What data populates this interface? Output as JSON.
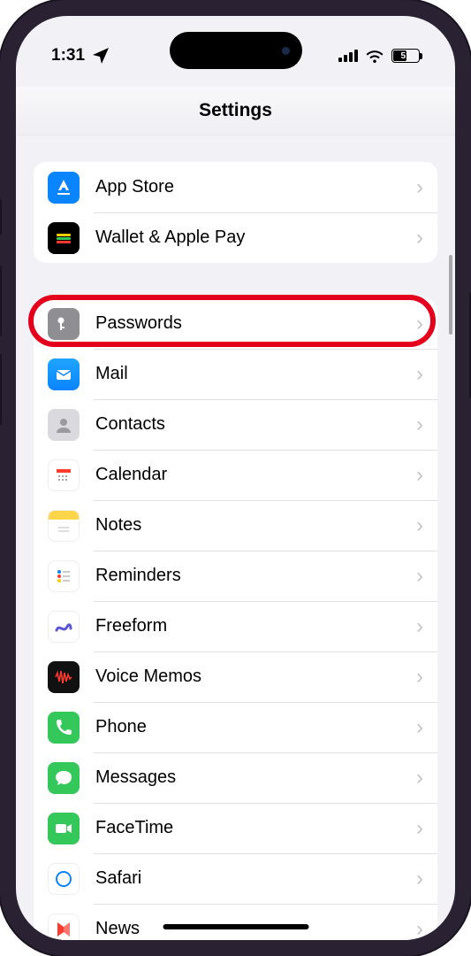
{
  "status": {
    "time": "1:31",
    "battery": "51"
  },
  "header": {
    "title": "Settings"
  },
  "groups": [
    {
      "items": [
        {
          "id": "appstore",
          "label": "App Store"
        },
        {
          "id": "wallet",
          "label": "Wallet & Apple Pay"
        }
      ]
    },
    {
      "items": [
        {
          "id": "passwords",
          "label": "Passwords",
          "highlighted": true
        },
        {
          "id": "mail",
          "label": "Mail"
        },
        {
          "id": "contacts",
          "label": "Contacts"
        },
        {
          "id": "calendar",
          "label": "Calendar"
        },
        {
          "id": "notes",
          "label": "Notes"
        },
        {
          "id": "reminders",
          "label": "Reminders"
        },
        {
          "id": "freeform",
          "label": "Freeform"
        },
        {
          "id": "voicememos",
          "label": "Voice Memos"
        },
        {
          "id": "phone",
          "label": "Phone"
        },
        {
          "id": "messages",
          "label": "Messages"
        },
        {
          "id": "facetime",
          "label": "FaceTime"
        },
        {
          "id": "safari",
          "label": "Safari"
        },
        {
          "id": "news",
          "label": "News"
        }
      ]
    }
  ],
  "annotation": {
    "color": "#e4001c"
  }
}
